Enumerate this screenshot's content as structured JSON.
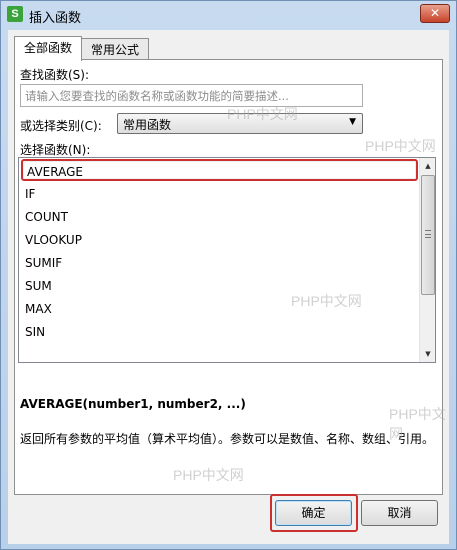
{
  "window": {
    "title": "插入函数",
    "app_icon": "S",
    "close_symbol": "✕"
  },
  "tabs": [
    {
      "label": "全部函数",
      "active": true
    },
    {
      "label": "常用公式",
      "active": false
    }
  ],
  "search": {
    "label": "查找函数(S):",
    "placeholder": "请输入您要查找的函数名称或函数功能的简要描述..."
  },
  "category": {
    "label": "或选择类别(C):",
    "selected": "常用函数"
  },
  "function_list": {
    "label": "选择函数(N):",
    "items": [
      "AVERAGE",
      "IF",
      "COUNT",
      "VLOOKUP",
      "SUMIF",
      "SUM",
      "MAX",
      "SIN"
    ],
    "selected": "AVERAGE"
  },
  "details": {
    "syntax": "AVERAGE(number1, number2, ...)",
    "description": "返回所有参数的平均值（算术平均值）。参数可以是数值、名称、数组、引用。"
  },
  "buttons": {
    "ok": "确定",
    "cancel": "取消"
  },
  "watermarks": [
    "PHP中文网",
    "PHP中文网",
    "PHP中文网",
    "PHP中文网",
    "PHP中文网"
  ],
  "colors": {
    "highlight": "#cc2f2f",
    "titlebar": "#c7daf0",
    "close_button": "#c7432a"
  }
}
